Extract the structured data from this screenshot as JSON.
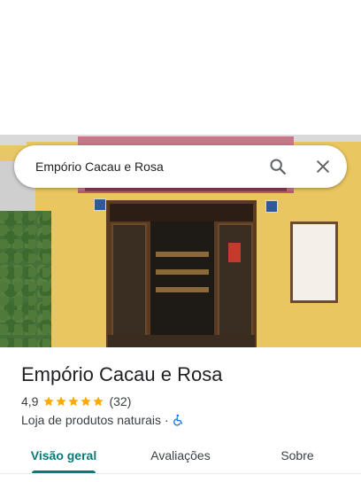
{
  "search": {
    "query": "Empório Cacau e Rosa"
  },
  "place": {
    "name": "Empório Cacau e Rosa",
    "rating": "4,9",
    "stars": 5,
    "review_count": "(32)",
    "category": "Loja de produtos naturais",
    "separator": "·"
  },
  "icons": {
    "search": "search-icon",
    "close": "close-icon",
    "star": "star-icon",
    "accessibility": "wheelchair-icon"
  },
  "tabs": [
    {
      "label": "Visão geral",
      "active": true
    },
    {
      "label": "Avaliações",
      "active": false
    },
    {
      "label": "Sobre",
      "active": false
    }
  ],
  "colors": {
    "accent": "#0b7a75",
    "star": "#f9ab00",
    "accessibility": "#1a73e8"
  }
}
